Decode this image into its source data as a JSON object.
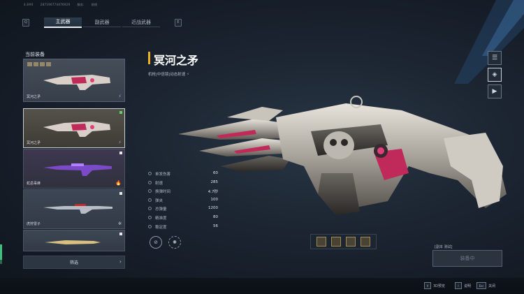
{
  "top_info": [
    "4.8#0",
    "287196774476929",
    "服务:",
    "前线"
  ],
  "tabs": {
    "left_key": "Q",
    "right_key": "E",
    "items": [
      "主武器",
      "副武器",
      "近战武器"
    ]
  },
  "panel": {
    "title": "当前装备",
    "current_weapon": "冥河之矛",
    "list": [
      {
        "name": "冥河之矛",
        "selected": true
      },
      {
        "name": "蛇岳毒蜂",
        "selected": false
      },
      {
        "name": "虎狩雷子",
        "selected": false
      },
      {
        "name": "",
        "selected": false
      }
    ],
    "filter_label": "筛选"
  },
  "weapon": {
    "name": "冥河之矛",
    "subtitle": "机枪|中倍镜|动态射速"
  },
  "stats": [
    {
      "label": "单发伤害",
      "value": "60"
    },
    {
      "label": "射速",
      "value": "285"
    },
    {
      "label": "换弹时间",
      "value": "4.7秒"
    },
    {
      "label": "弹夹",
      "value": "100"
    },
    {
      "label": "总弹量",
      "value": "1200"
    },
    {
      "label": "精准度",
      "value": "80"
    },
    {
      "label": "稳定度",
      "value": "56"
    }
  ],
  "equip": {
    "info": "[副本 测试]",
    "button": "装备中"
  },
  "hints": [
    {
      "key": "V",
      "label": "3D预览"
    },
    {
      "key": "I",
      "label": "说明"
    },
    {
      "key": "Esc",
      "label": "关闭"
    }
  ],
  "colors": {
    "accent": "#f0b020",
    "selected_check": "#5fd06a",
    "weapon_magenta": "#c02a5a"
  }
}
